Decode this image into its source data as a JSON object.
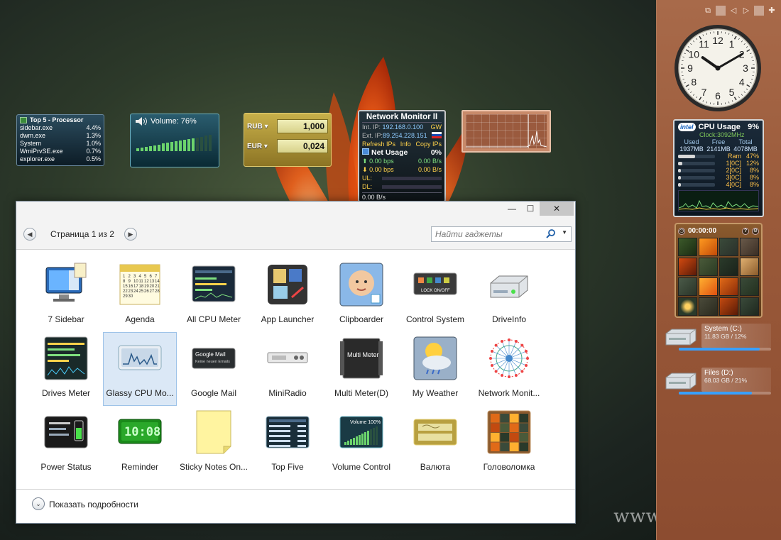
{
  "watermark": "www.wincore.ru",
  "colors": {
    "accent_blue": "#38a0ff",
    "selection": "#dbe8f6",
    "sidebar": "#9a5a3a"
  },
  "sidebar": {
    "controls": [
      "restore-icon",
      "prev-icon",
      "next-icon",
      "add-icon"
    ],
    "clock": {
      "hour": 10,
      "minute": 10,
      "numerals": [
        "12",
        "1",
        "2",
        "3",
        "4",
        "5",
        "6",
        "7",
        "8",
        "9",
        "10",
        "11"
      ]
    },
    "cpu_usage": {
      "title": "CPU Usage",
      "percent": "9%",
      "logo": "intel",
      "clock": "Clock:3092MHz",
      "mem_headers": [
        "Used",
        "Free",
        "Total"
      ],
      "mem_values": [
        "1937MB",
        "2141MB",
        "4078MB"
      ],
      "rows": [
        {
          "label": "Ram",
          "value": "47%",
          "fill": 0.47
        },
        {
          "label": "1[0C]",
          "value": "12%",
          "fill": 0.12
        },
        {
          "label": "2[0C]",
          "value": "8%",
          "fill": 0.08
        },
        {
          "label": "3[0C]",
          "value": "8%",
          "fill": 0.08
        },
        {
          "label": "4[0C]",
          "value": "8%",
          "fill": 0.08
        }
      ]
    },
    "puzzle": {
      "timer": "00:00:00"
    },
    "drives": [
      {
        "name": "System (C:)",
        "size": "11.83 GB / 12%",
        "fill": 0.88
      },
      {
        "name": "Files (D:)",
        "size": "68.03 GB / 21%",
        "fill": 0.79
      }
    ]
  },
  "desktop": {
    "top5": {
      "title": "Top 5 - Processor",
      "rows": [
        {
          "name": "sidebar.exe",
          "value": "4.4%"
        },
        {
          "name": "dwm.exe",
          "value": "1.3%"
        },
        {
          "name": "System",
          "value": "1.0%"
        },
        {
          "name": "WmiPrvSE.exe",
          "value": "0.7%"
        },
        {
          "name": "explorer.exe",
          "value": "0.5%"
        }
      ]
    },
    "volume": {
      "label": "Volume: 76%",
      "level": 0.76
    },
    "currency": {
      "rows": [
        {
          "code": "RUB",
          "value": "1,000"
        },
        {
          "code": "EUR",
          "value": "0,024"
        }
      ]
    },
    "network": {
      "title": "Network Monitor II",
      "int_ip_label": "Int. IP:",
      "int_ip": "192.168.0.100",
      "int_gw": "GW",
      "ext_ip_label": "Ext. IP:",
      "ext_ip": "89.254.228.151",
      "refresh": "Refresh IPs",
      "info": "Info",
      "copy": "Copy IPs",
      "net_usage": "Net Usage",
      "net_pct": "0%",
      "up_bps": "0.00 bps",
      "up_bs": "0.00 B/s",
      "down_bps": "0.00 bps",
      "down_bs": "0.00 B/s",
      "ul": "UL:",
      "dl": "DL:",
      "bottom": "0.00 B/s"
    }
  },
  "window": {
    "controls": {
      "minimize": "—",
      "maximize": "☐",
      "close": "✕"
    },
    "page_label": "Страница 1 из 2",
    "search_placeholder": "Найти гаджеты",
    "details_label": "Показать подробности",
    "gadgets": [
      {
        "label": "7 Sidebar",
        "icon": "sidebar-monitor-icon"
      },
      {
        "label": "Agenda",
        "icon": "calendar-icon"
      },
      {
        "label": "All CPU Meter",
        "icon": "cpu-meter-icon"
      },
      {
        "label": "App Launcher",
        "icon": "app-launcher-icon"
      },
      {
        "label": "Clipboarder",
        "icon": "clipboard-baby-icon"
      },
      {
        "label": "Control System",
        "icon": "control-system-icon"
      },
      {
        "label": "DriveInfo",
        "icon": "hard-drive-icon"
      },
      {
        "label": "Drives Meter",
        "icon": "drives-meter-icon"
      },
      {
        "label": "Glassy CPU Mo...",
        "icon": "glassy-cpu-icon",
        "selected": true
      },
      {
        "label": "Google Mail",
        "icon": "google-mail-icon",
        "thumb_text": "Google Mail",
        "thumb_sub": "Keine neuen Emails"
      },
      {
        "label": "MiniRadio",
        "icon": "radio-icon"
      },
      {
        "label": "Multi Meter(D)",
        "icon": "multi-meter-icon",
        "thumb_text": "Multi Meter"
      },
      {
        "label": "My Weather",
        "icon": "weather-icon"
      },
      {
        "label": "Network Monit...",
        "icon": "network-globe-icon"
      },
      {
        "label": "Power Status",
        "icon": "battery-icon"
      },
      {
        "label": "Reminder",
        "icon": "reminder-clock-icon",
        "thumb_text": "10:08"
      },
      {
        "label": "Sticky Notes On...",
        "icon": "sticky-note-icon"
      },
      {
        "label": "Top Five",
        "icon": "top-five-icon"
      },
      {
        "label": "Volume Control",
        "icon": "volume-icon"
      },
      {
        "label": "Валюта",
        "icon": "currency-icon"
      },
      {
        "label": "Головоломка",
        "icon": "puzzle-icon"
      }
    ]
  }
}
